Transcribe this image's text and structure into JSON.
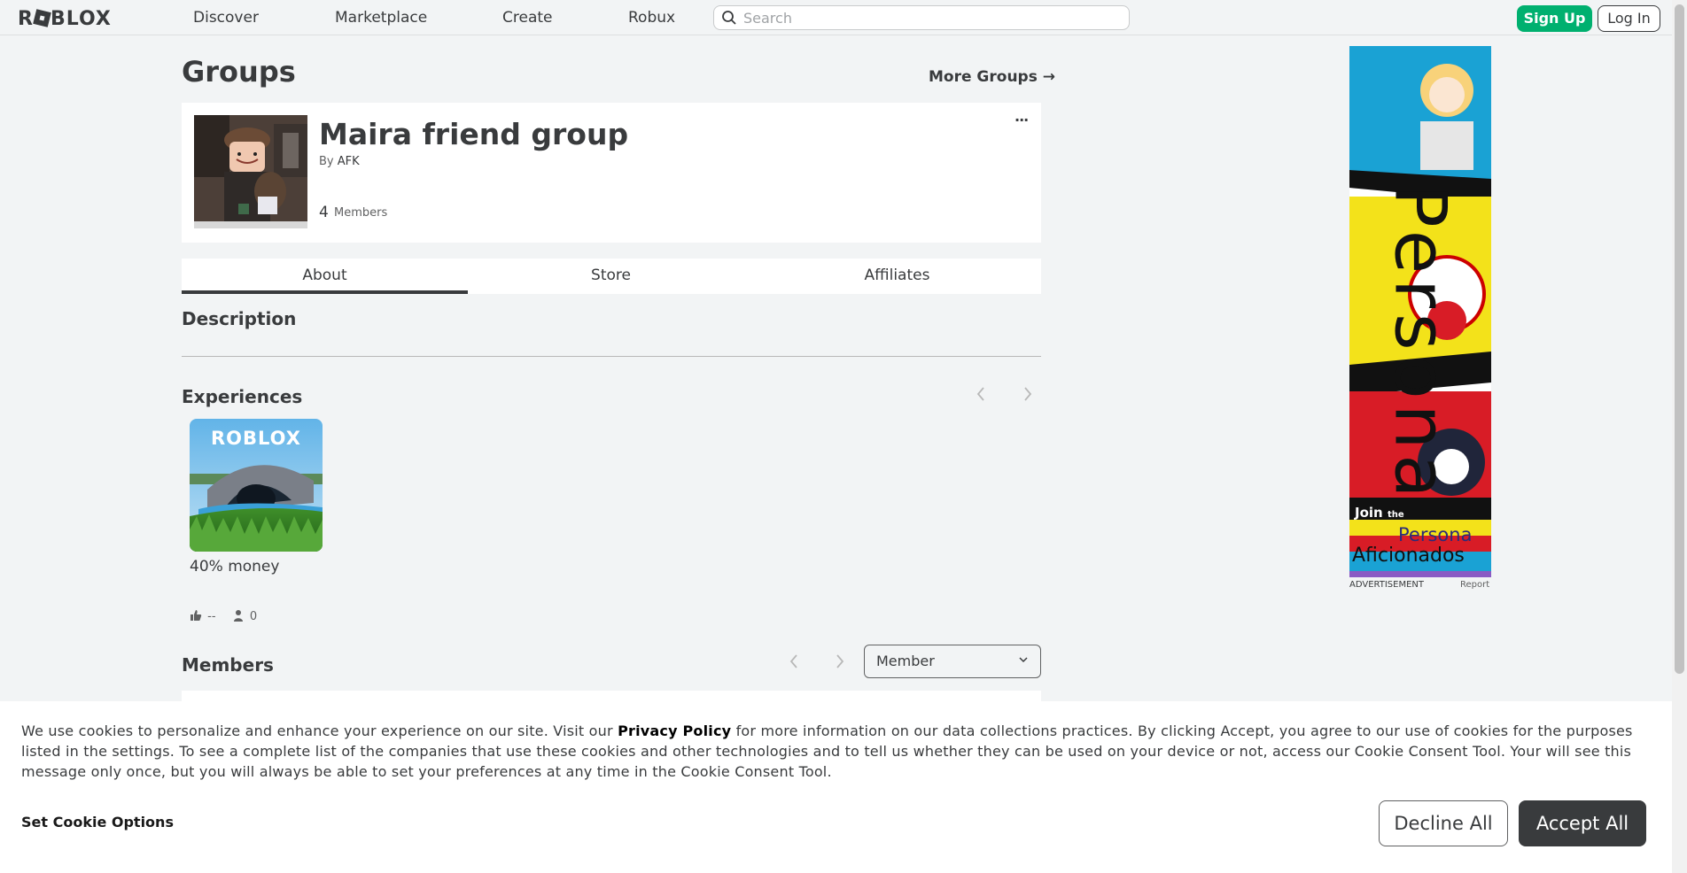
{
  "nav": {
    "logo": "ROBLOX",
    "links": [
      "Discover",
      "Marketplace",
      "Create",
      "Robux"
    ],
    "search_placeholder": "Search",
    "signup_label": "Sign Up",
    "login_label": "Log In"
  },
  "page": {
    "title": "Groups",
    "more_groups": "More Groups →"
  },
  "group": {
    "name": "Maira friend group",
    "by_prefix": "By",
    "owner": "AFK",
    "member_count": "4",
    "members_label": "Members",
    "more_icon": "···"
  },
  "tabs": [
    "About",
    "Store",
    "Affiliates"
  ],
  "about": {
    "description_heading": "Description",
    "experiences_heading": "Experiences",
    "experience": {
      "name": "40% money",
      "likes": "--",
      "players": "0",
      "thumb_logo": "ROBLOX"
    },
    "members_heading": "Members",
    "member_role_selected": "Member"
  },
  "ad": {
    "label": "ADVERTISEMENT",
    "report": "Report",
    "text_join": "Join",
    "text_the": "the",
    "text_persona": "Persona",
    "text_aficionados": "Aficionados",
    "vertical_text": "Persona"
  },
  "cookie": {
    "text_before": "We use cookies to personalize and enhance your experience on our site. Visit our ",
    "privacy_link": "Privacy Policy",
    "text_after": " for more information on our data collections practices. By clicking Accept, you agree to our use of cookies for the purposes listed in the settings. To see a complete list of the companies that use these cookies and other technologies and to tell us whether they can be used on your device or not, access our Cookie Consent Tool. Your will see this message only once, but you will always be able to set your preferences at any time in the Cookie Consent Tool.",
    "options_label": "Set Cookie Options",
    "decline_label": "Decline All",
    "accept_label": "Accept All"
  },
  "colors": {
    "signup_green": "#00b06f",
    "text_dark": "#393b3d",
    "page_bg": "#f2f4f5"
  }
}
